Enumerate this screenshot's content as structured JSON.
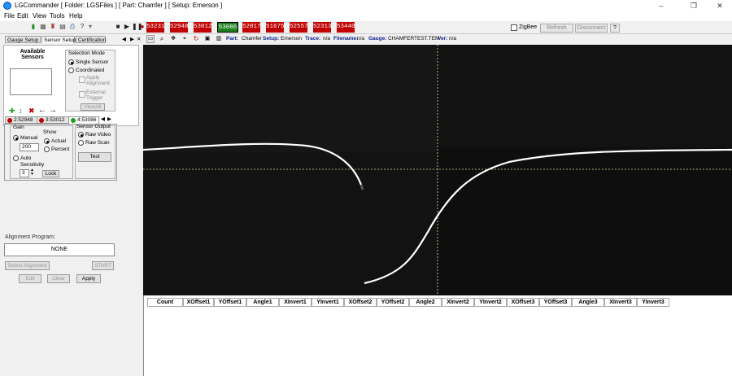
{
  "window": {
    "title": "LGCommander  [ Folder: LGSFiles ] [ Part: Chamfer ] [ Setup: Emerson ]",
    "min_glyph": "–",
    "max_glyph": "❐",
    "close_glyph": "✕"
  },
  "menu": [
    "File",
    "Edit",
    "View",
    "Tools",
    "Help"
  ],
  "toolbar": {
    "sensors": [
      "53231",
      "52948",
      "53012",
      "53086",
      "52817",
      "51675",
      "52557",
      "52313",
      "53440"
    ],
    "selected_sensor_index": 3,
    "zigbee_label": "ZigBee",
    "refresh_label": "Refresh",
    "disconnect_label": "Disconnect",
    "help_label": "?"
  },
  "left": {
    "tabs": [
      "Gauge Setup",
      "Sensor Setup",
      "Certification"
    ],
    "available_sensors_title": "Available\nSensors",
    "selection_mode_title": "Selection Mode",
    "single_sensor": "Single Sensor",
    "coordinated": "Coordinated",
    "apply_alignment": "Apply\nAlignment",
    "external_trigger": "External\nTrigger",
    "view_all": "ViewAll",
    "sensor_tabs": [
      {
        "label": "2:52948",
        "color": "#c00000"
      },
      {
        "label": "3:53012",
        "color": "#c00000"
      },
      {
        "label": "4:53086",
        "color": "#1e9e1e"
      }
    ],
    "gain_title": "Gain",
    "manual": "Manual",
    "gain_value": "200",
    "show_title": "Show",
    "actual": "Actual",
    "percent": "Percent",
    "auto": "Auto",
    "sensitivity": "Sensitivity",
    "sensitivity_value": "3",
    "lock": "Lock",
    "sensor_output_title": "Sensor Output",
    "raw_video": "Raw Video",
    "raw_scan": "Raw Scan",
    "test": "Test",
    "alignment_program_title": "Alignment Program:",
    "alignment_program_value": "NONE",
    "select_alignment": "Select Alignment",
    "start": "START",
    "edit": "Edit",
    "clear": "Clear",
    "apply": "Apply"
  },
  "info": {
    "part_label": "Part:",
    "part_value": "Chamfer",
    "setup_label": "Setup:",
    "setup_value": "Emerson",
    "trace_label": "Trace:",
    "trace_value": "n/a",
    "filename_label": "Filename:",
    "filename_value": "n/a",
    "gauge_label": "Gauge:",
    "gauge_value": "CHAMFERTEST.TEM",
    "ver_label": "Ver:",
    "ver_value": "n/a"
  },
  "results_table": {
    "columns": [
      "Count",
      "XOffset1",
      "YOffset1",
      "Angle1",
      "XInvert1",
      "YInvert1",
      "XOffset2",
      "YOffset2",
      "Angle2",
      "XInvert2",
      "YInvert2",
      "XOffset3",
      "YOffset3",
      "Angle3",
      "XInvert3",
      "YInvert3"
    ]
  },
  "colors": {
    "sensor_red": "#c00000",
    "sensor_green": "#1e7f1e",
    "trace": "#ffffff",
    "crosshair": "#f0f0b0",
    "viewer_bg": "#111111"
  }
}
